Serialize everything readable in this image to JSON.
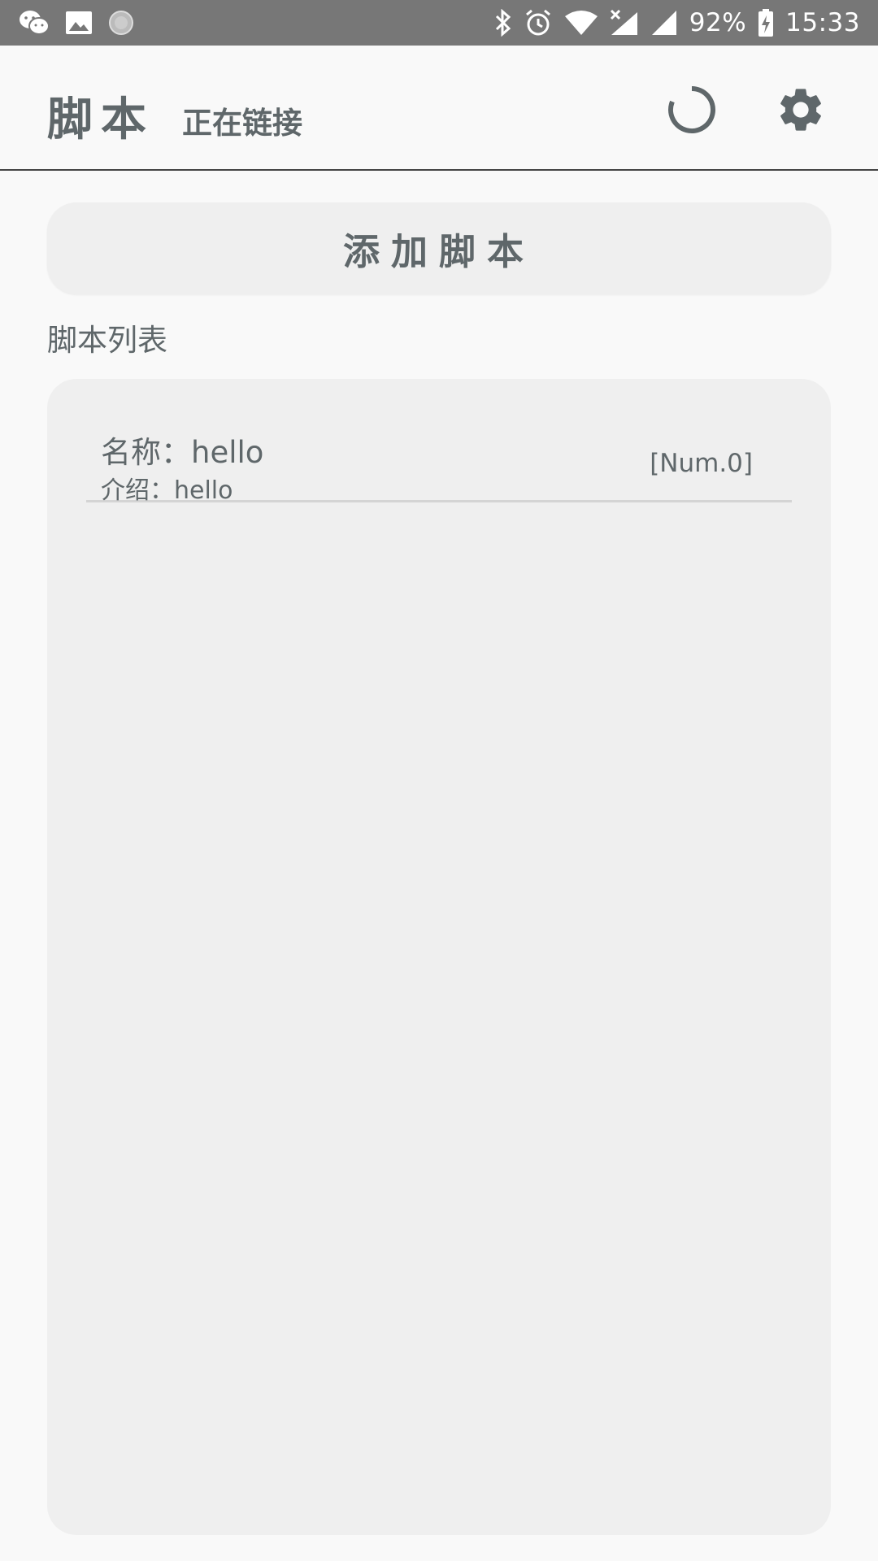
{
  "status_bar": {
    "left_icons": [
      "wechat-icon",
      "image-icon",
      "record-icon"
    ],
    "right_icons": [
      "bluetooth-icon",
      "alarm-icon",
      "wifi-icon",
      "cell-signal-off-icon",
      "cell-signal-icon"
    ],
    "battery_percent": "92%",
    "battery_icon": "battery-charging-icon",
    "time": "15:33"
  },
  "header": {
    "title": "脚本",
    "connection_status": "正在链接",
    "spinner_icon": "loading-spinner-icon",
    "settings_icon": "gear-icon"
  },
  "actions": {
    "add_script_label": "添加脚本"
  },
  "script_list": {
    "section_label": "脚本列表",
    "items": [
      {
        "name": "名称：hello",
        "description": "介绍：hello",
        "number": "[Num.0]"
      }
    ]
  },
  "colors": {
    "status_bar": "#777777",
    "background": "#f9f9f9",
    "card": "#efefef",
    "text": "#5f676a"
  }
}
